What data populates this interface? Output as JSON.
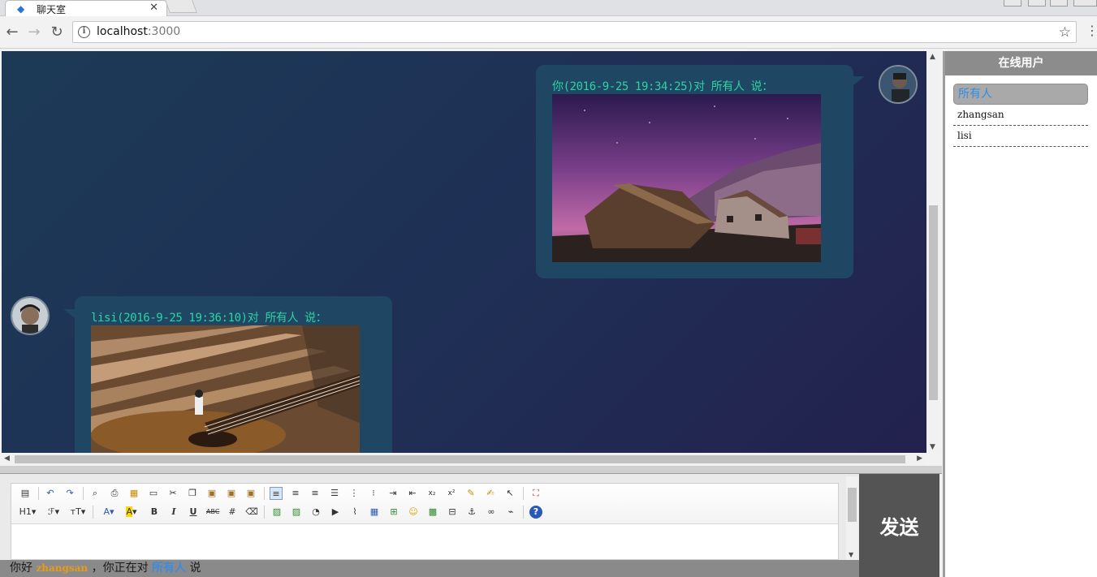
{
  "browser": {
    "tab_title": "聊天室",
    "url_host": "localhost",
    "url_port": ":3000"
  },
  "sidebar": {
    "title": "在线用户",
    "users": [
      {
        "name": "所有人"
      },
      {
        "name": "zhangsan"
      },
      {
        "name": "lisi"
      }
    ]
  },
  "messages": [
    {
      "meta": "你(2016-9-25 19:34:25)对 所有人 说：",
      "side": "right",
      "image": "night-sky-cabins"
    },
    {
      "meta": "lisi(2016-9-25 19:36:10)对 所有人 说：",
      "side": "left",
      "image": "guitar-bench"
    }
  ],
  "editor": {
    "row1_icons": [
      "source-icon",
      "undo-icon",
      "redo-icon",
      "preview-icon",
      "print-icon",
      "template-icon",
      "paste-word-icon",
      "cut-icon",
      "copy-icon",
      "paste-icon",
      "paste-text-icon",
      "paste-html-icon",
      "align-left-icon",
      "align-center-icon",
      "align-right-icon",
      "align-justify-icon",
      "ordered-list-icon",
      "unordered-list-icon",
      "indent-icon",
      "outdent-icon",
      "subscript-icon",
      "superscript-icon",
      "clear-format-icon",
      "select-all-icon",
      "cursor-icon",
      "fullscreen-icon"
    ],
    "heading_label": "H1",
    "font_label": "ℱ",
    "size_label": "тT"
  },
  "send_label": "发送",
  "status": {
    "greeting": "你好",
    "username": "zhangsan",
    "middle": "，你正在对",
    "target": "所有人",
    "end": "说"
  },
  "colors": {
    "chat_bg": "#1f2f55",
    "bubble": "#1f4663",
    "meta_text": "#2ed3a4",
    "sidebar_head": "#8c8c8c",
    "send_button": "#545454"
  }
}
